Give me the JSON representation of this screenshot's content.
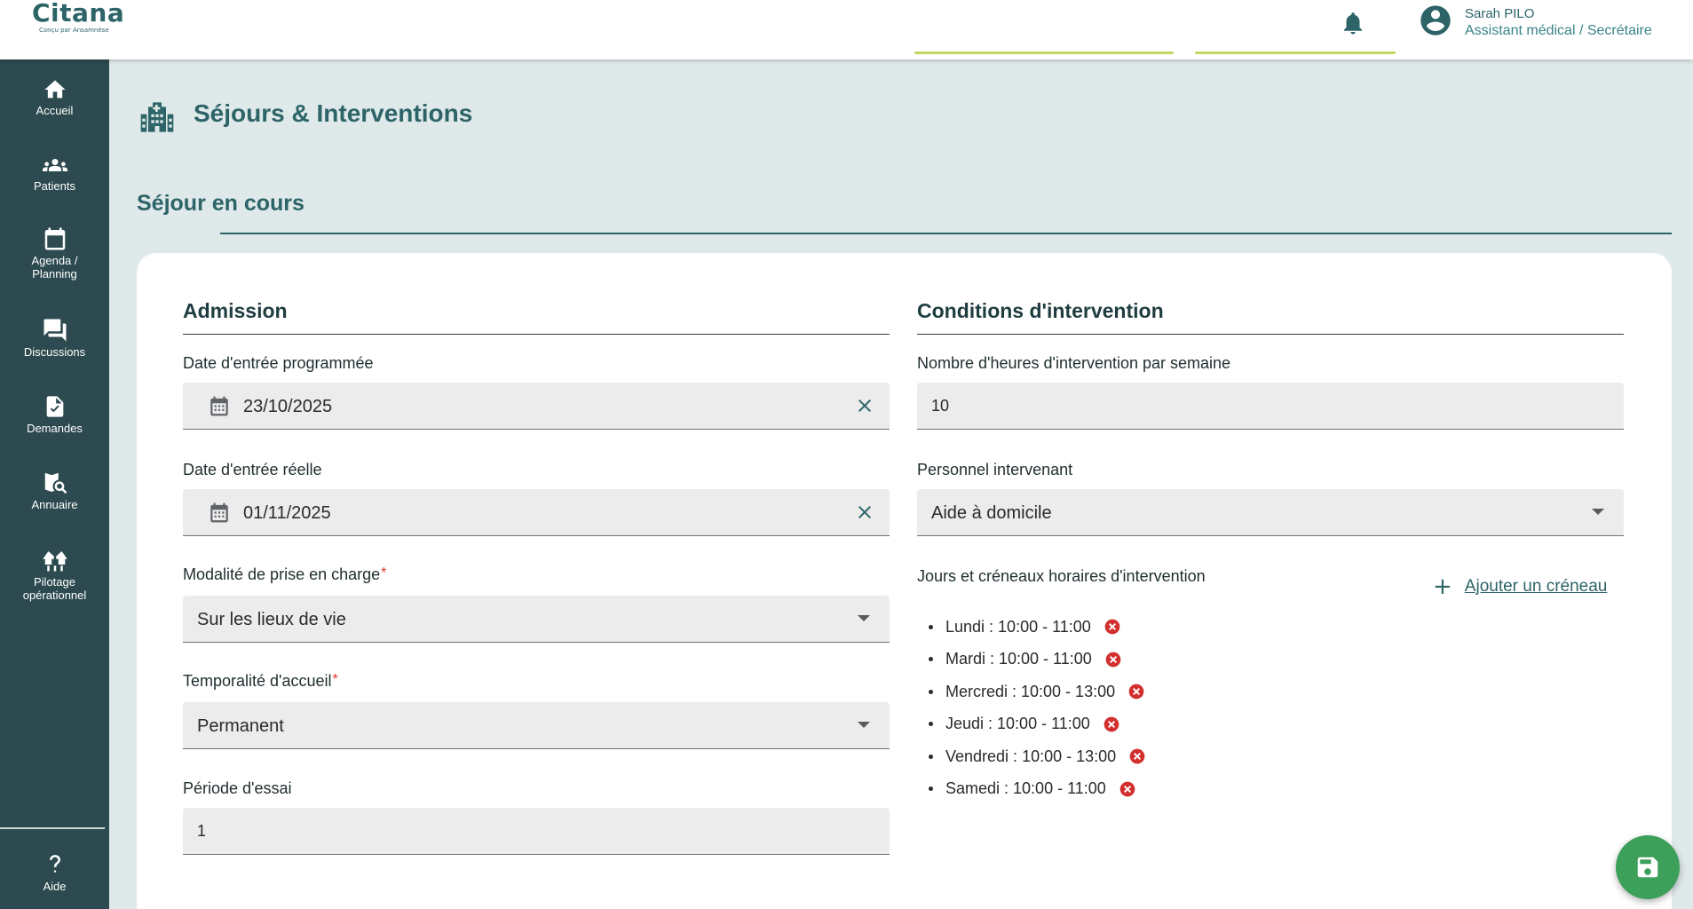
{
  "brand": {
    "name": "Citana",
    "tagline": "Conçu par Ansamnèse"
  },
  "user": {
    "name": "Sarah PILO",
    "role": "Assistant médical / Secrétaire"
  },
  "sidebar": {
    "items": [
      {
        "label": "Accueil",
        "icon": "home-icon"
      },
      {
        "label": "Patients",
        "icon": "patients-icon"
      },
      {
        "label": "Agenda / Planning",
        "icon": "calendar-icon"
      },
      {
        "label": "Discussions",
        "icon": "chat-icon"
      },
      {
        "label": "Demandes",
        "icon": "document-icon"
      },
      {
        "label": "Annuaire",
        "icon": "directory-icon"
      },
      {
        "label": "Pilotage opérationnel",
        "icon": "pilotage-icon"
      }
    ],
    "help": {
      "label": "Aide",
      "icon": "help-icon"
    }
  },
  "page": {
    "title": "Séjours & Interventions",
    "section": "Séjour en cours"
  },
  "admission": {
    "heading": "Admission",
    "date_prevue": {
      "label": "Date d'entrée programmée",
      "value": "23/10/2025"
    },
    "date_reelle": {
      "label": "Date d'entrée réelle",
      "value": "01/11/2025"
    },
    "modalite": {
      "label": "Modalité de prise en charge",
      "value": "Sur les lieux de vie"
    },
    "temporalite": {
      "label": "Temporalité d'accueil",
      "value": "Permanent"
    },
    "essai": {
      "label": "Période d'essai",
      "value": "1"
    }
  },
  "conditions": {
    "heading": "Conditions d'intervention",
    "heures": {
      "label": "Nombre d'heures d'intervention par semaine",
      "value": "10"
    },
    "personnel": {
      "label": "Personnel intervenant",
      "value": "Aide à domicile"
    },
    "creneaux_label": "Jours et créneaux horaires d'intervention",
    "add_slot": "Ajouter un créneau",
    "slots": [
      "Lundi : 10:00 - 11:00",
      "Mardi : 10:00 - 11:00",
      "Mercredi : 10:00 - 13:00",
      "Jeudi : 10:00 - 11:00",
      "Vendredi : 10:00 - 13:00",
      "Samedi : 10:00 - 11:00"
    ]
  },
  "colors": {
    "primary": "#2d6468",
    "sidebar": "#2c4a4f",
    "background": "#dfe9ea",
    "save": "#3da05a",
    "delete": "#d32f2f"
  },
  "icons": {
    "save": "save-icon",
    "notifications": "bell-icon",
    "account": "account-icon"
  }
}
